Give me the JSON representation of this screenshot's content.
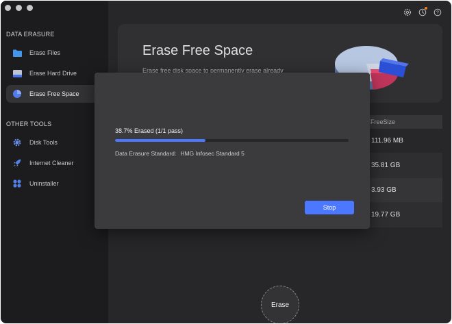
{
  "sidebar": {
    "section1": "DATA ERASURE",
    "items1": [
      {
        "label": "Erase Files",
        "icon": "folder-icon"
      },
      {
        "label": "Erase Hard Drive",
        "icon": "hard-drive-icon"
      },
      {
        "label": "Erase Free Space",
        "icon": "pie-chart-icon"
      }
    ],
    "section2": "OTHER TOOLS",
    "items2": [
      {
        "label": "Disk Tools",
        "icon": "gear-icon"
      },
      {
        "label": "Internet Cleaner",
        "icon": "rocket-icon"
      },
      {
        "label": "Uninstaller",
        "icon": "apps-grid-icon"
      }
    ]
  },
  "hero": {
    "title": "Erase Free Space",
    "subtitle": "Erase free disk space to permanently erase already"
  },
  "table": {
    "column": "FreeSize",
    "rows": [
      "111.96 MB",
      "35.81 GB",
      "3.93 GB",
      "19.77 GB"
    ]
  },
  "dialog": {
    "progress_text": "38.7% Erased (1/1 pass)",
    "progress_percent": 38.7,
    "standard_label": "Data Erasure Standard:",
    "standard_value": "HMG Infosec Standard 5",
    "stop_label": "Stop"
  },
  "erase_label": "Erase",
  "colors": {
    "accent": "#4c78ff",
    "sidebar_bg": "#1f1f21",
    "window_bg": "#2b2b2d"
  }
}
